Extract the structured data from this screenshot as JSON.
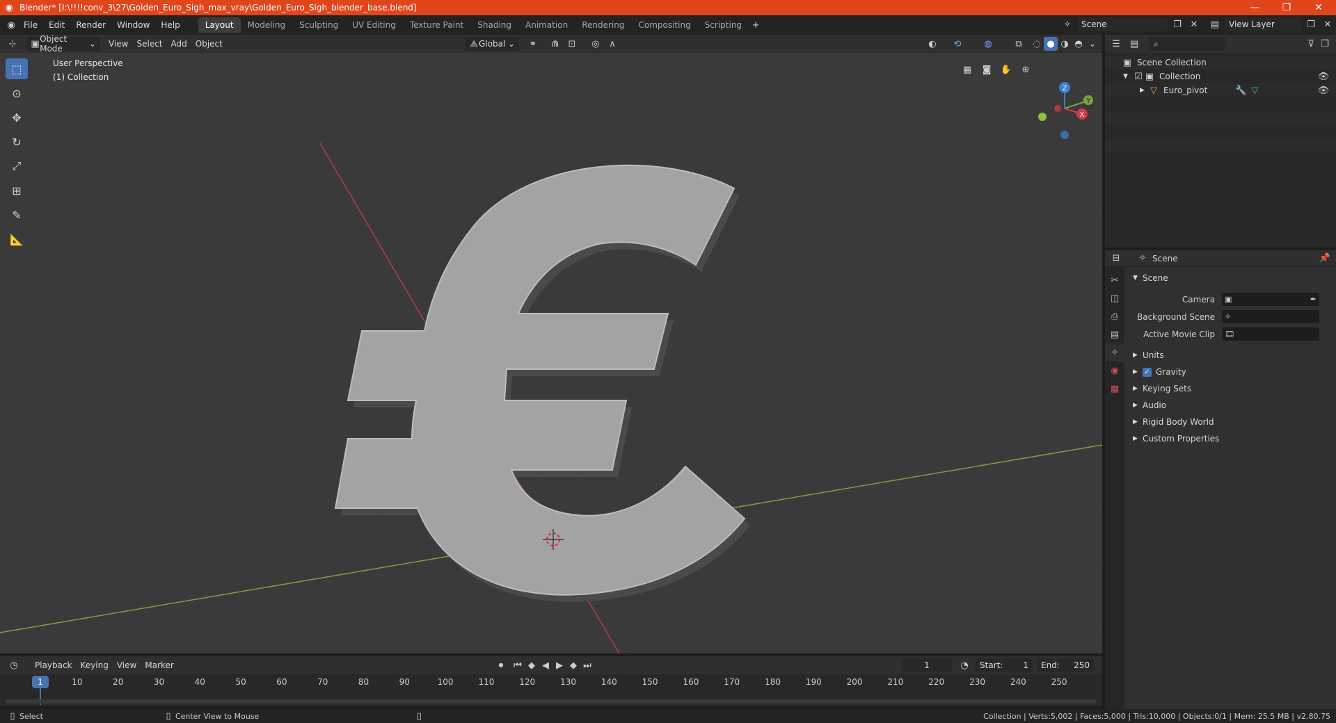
{
  "window": {
    "title": "Blender* [I:\\!!!!conv_3\\27\\Golden_Euro_Sigh_max_vray\\Golden_Euro_Sigh_blender_base.blend]",
    "minimize": "—",
    "maximize": "❐",
    "close": "✕"
  },
  "menu": {
    "file": "File",
    "edit": "Edit",
    "render": "Render",
    "window": "Window",
    "help": "Help"
  },
  "workspaces": [
    "Layout",
    "Modeling",
    "Sculpting",
    "UV Editing",
    "Texture Paint",
    "Shading",
    "Animation",
    "Rendering",
    "Compositing",
    "Scripting"
  ],
  "scene_field": "Scene",
  "view_layer_field": "View Layer",
  "viewport_header": {
    "mode": "Object Mode",
    "view": "View",
    "select": "Select",
    "add": "Add",
    "object": "Object",
    "transform_orientation": "Global"
  },
  "viewport": {
    "perspective": "User Perspective",
    "collection": "(1) Collection",
    "gizmo": {
      "z": "Z",
      "y": "Y",
      "x": "X"
    }
  },
  "outliner": {
    "scene_collection": "Scene Collection",
    "collection": "Collection",
    "object": "Euro_pivot"
  },
  "properties": {
    "header": "Scene",
    "section": "Scene",
    "camera_label": "Camera",
    "background_label": "Background Scene",
    "clip_label": "Active Movie Clip",
    "subsections": [
      "Units",
      "Gravity",
      "Keying Sets",
      "Audio",
      "Rigid Body World",
      "Custom Properties"
    ]
  },
  "timeline": {
    "playback": "Playback",
    "keying": "Keying",
    "view": "View",
    "marker": "Marker",
    "current_frame": "1",
    "start_label": "Start:",
    "start": "1",
    "end_label": "End:",
    "end": "250",
    "ticks": [
      "10",
      "20",
      "30",
      "40",
      "50",
      "60",
      "70",
      "80",
      "90",
      "100",
      "110",
      "120",
      "130",
      "140",
      "150",
      "160",
      "170",
      "180",
      "190",
      "200",
      "210",
      "220",
      "230",
      "240",
      "250"
    ],
    "playhead": "1"
  },
  "status": {
    "select": "Select",
    "center": "Center View to Mouse",
    "stats": "Collection | Verts:5,002 | Faces:5,000 | Tris:10,000 | Objects:0/1 | Mem: 25.5 MB | v2.80.75"
  },
  "colors": {
    "accent": "#4772b3",
    "titlebar": "#e0451c",
    "x_axis": "#d23b4b",
    "y_axis": "#7aa33a",
    "z_axis": "#3b7fd2"
  }
}
